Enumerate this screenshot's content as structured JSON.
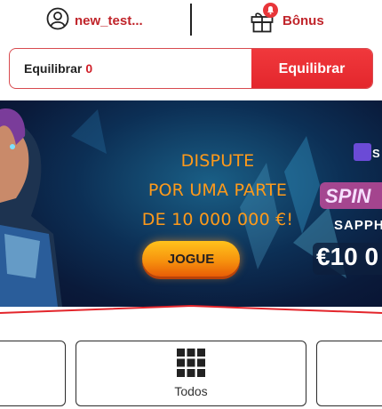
{
  "header": {
    "username": "new_test...",
    "bonus_label": "Bônus"
  },
  "balance": {
    "label": "Equilibrar",
    "amount": "0",
    "button_label": "Equilibrar"
  },
  "banner": {
    "line1": "DISPUTE",
    "line2": "POR UMA PARTE",
    "line3": "DE 10 000 000 €!",
    "cta_label": "JOGUE",
    "game_title_1": "SPIN",
    "game_title_2": "SAPPH",
    "prize": "€10 0",
    "badge": "S"
  },
  "categories": {
    "main_label": "Todos"
  },
  "colors": {
    "brand_red": "#e3262c",
    "banner_orange": "#ff9a1a",
    "cta_orange": "#f7930e"
  }
}
